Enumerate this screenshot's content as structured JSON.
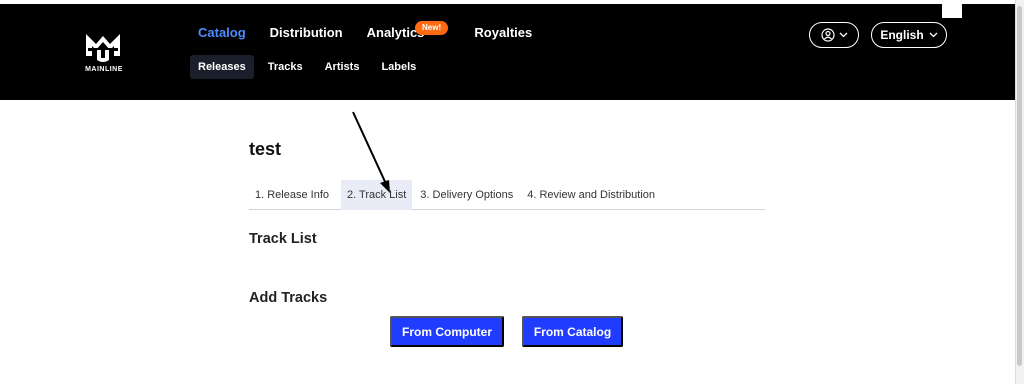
{
  "brand": {
    "logo_text": "MAINLINE"
  },
  "topnav": [
    {
      "label": "Catalog",
      "active": true
    },
    {
      "label": "Distribution",
      "active": false
    },
    {
      "label": "Analytics",
      "active": false
    },
    {
      "label": "Royalties",
      "active": false
    }
  ],
  "badge": {
    "label": "New!",
    "color": "#ff6a13"
  },
  "subnav": [
    {
      "label": "Releases",
      "active": true
    },
    {
      "label": "Tracks",
      "active": false
    },
    {
      "label": "Artists",
      "active": false
    },
    {
      "label": "Labels",
      "active": false
    }
  ],
  "user_menu": {
    "icon": "user-circle-icon"
  },
  "language": {
    "label": "English"
  },
  "page": {
    "title": "test"
  },
  "steps": [
    {
      "label": "1. Release Info",
      "active": false
    },
    {
      "label": "2. Track List",
      "active": true
    },
    {
      "label": "3. Delivery Options",
      "active": false
    },
    {
      "label": "4. Review and Distribution",
      "active": false
    }
  ],
  "sections": {
    "track_list": "Track List",
    "add_tracks": "Add Tracks"
  },
  "buttons": {
    "from_computer": "From Computer",
    "from_catalog": "From Catalog"
  },
  "colors": {
    "header_bg": "#000000",
    "accent": "#4f8bff",
    "primary_button": "#1f3cff"
  }
}
